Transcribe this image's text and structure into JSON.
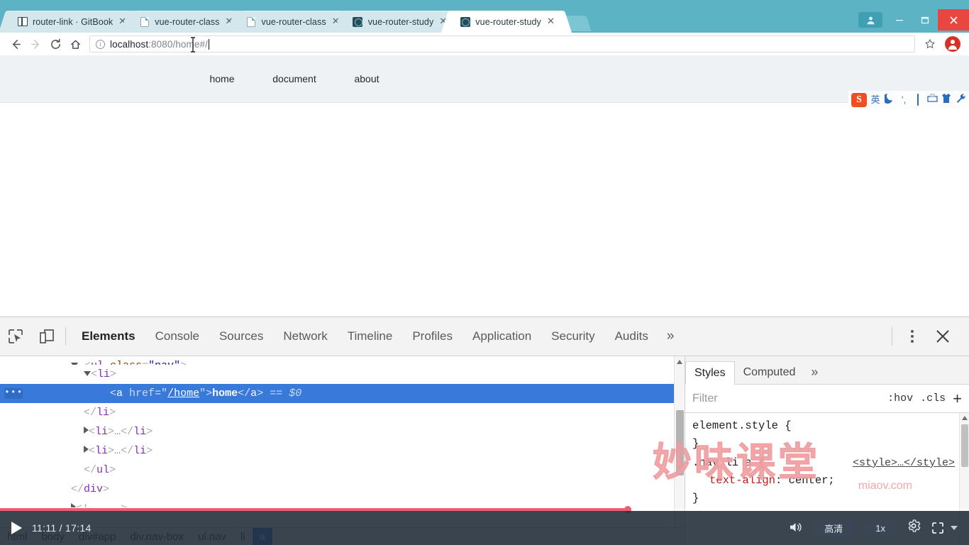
{
  "browser": {
    "tabs": [
      {
        "title": "router-link · GitBook",
        "favicon": "gitbook-icon",
        "active": false
      },
      {
        "title": "vue-router-class",
        "favicon": "page-icon",
        "active": false
      },
      {
        "title": "vue-router-class",
        "favicon": "page-icon",
        "active": false
      },
      {
        "title": "vue-router-study",
        "favicon": "vue-icon",
        "active": false
      },
      {
        "title": "vue-router-study",
        "favicon": "vue-icon",
        "active": true
      }
    ],
    "tab_close_label": "✕",
    "window_controls": {
      "user": "👤",
      "minimize": "—",
      "maximize": "❐",
      "close": "✕"
    },
    "toolbar": {
      "back": "←",
      "forward": "→",
      "reload": "⟳",
      "home": "⌂",
      "url_scheme_icon": "info-icon",
      "url_main": "localhost",
      "url_rest": ":8080/home#/",
      "url_full": "localhost:8080/home#/",
      "star": "☆"
    }
  },
  "page": {
    "nav": [
      {
        "label": "home",
        "href": "/home"
      },
      {
        "label": "document",
        "href": "/document"
      },
      {
        "label": "about",
        "href": "/about"
      }
    ],
    "ime": {
      "logo": "S",
      "items": [
        "英",
        "☽",
        "ʼ,",
        "keyboard-icon",
        "toolbox-icon",
        "shirt-icon",
        "wrench-icon"
      ]
    }
  },
  "devtools": {
    "left_icons": [
      "inspect-element-icon",
      "device-toolbar-icon"
    ],
    "tabs": [
      {
        "label": "Elements",
        "active": true
      },
      {
        "label": "Console",
        "active": false
      },
      {
        "label": "Sources",
        "active": false
      },
      {
        "label": "Network",
        "active": false
      },
      {
        "label": "Timeline",
        "active": false
      },
      {
        "label": "Profiles",
        "active": false
      },
      {
        "label": "Application",
        "active": false
      },
      {
        "label": "Security",
        "active": false
      },
      {
        "label": "Audits",
        "active": false
      }
    ],
    "more_tabs": "»",
    "kebab": "⋮",
    "close": "✕",
    "dom": {
      "lines": [
        {
          "id": "ul-open",
          "text": "<ul class=\"nav\">",
          "clipped": true
        },
        {
          "id": "li-open",
          "tag": "li",
          "marker": "▼"
        },
        {
          "id": "a-selected",
          "tagname": "a",
          "attr_name": "href",
          "attr_value": "/home",
          "inner_text": "home",
          "suffix": "== $0",
          "badge": "•••",
          "selected": true
        },
        {
          "id": "li-close",
          "text": "</li>"
        },
        {
          "id": "li-collapsed-1",
          "text": "<li>…</li>",
          "marker": "▶"
        },
        {
          "id": "li-collapsed-2",
          "text": "<li>…</li>",
          "marker": "▶"
        },
        {
          "id": "ul-close",
          "text": "</ul>"
        },
        {
          "id": "div-close",
          "text": "</div>"
        }
      ]
    },
    "breadcrumb": [
      "html",
      "body",
      "div#app",
      "div.nav-box",
      "ul.nav",
      "li",
      "a"
    ],
    "breadcrumb_active": "a",
    "styles": {
      "tabs": [
        {
          "label": "Styles",
          "active": true
        },
        {
          "label": "Computed",
          "active": false
        }
      ],
      "more": "»",
      "filter_placeholder": "Filter",
      "hov": ":hov",
      "cls": ".cls",
      "add": "+",
      "rules": [
        {
          "selector": "element.style {",
          "close": "}",
          "source": "",
          "declarations": []
        },
        {
          "selector": ".nav li a {",
          "close": "}",
          "source": "<style>…</style>",
          "declarations": [
            {
              "prop": "text-align",
              "value": "center;"
            }
          ]
        }
      ]
    }
  },
  "watermark": {
    "text": "妙味课堂",
    "site": "miaov.com"
  },
  "player": {
    "play_icon": "play-icon",
    "time": "11:11 / 17:14",
    "current_time": "11:11",
    "duration": "17:14",
    "quality": "高清",
    "speed": "1x",
    "gear": "⚙",
    "volume_icon": "volume-icon",
    "fullscreen_icon": "fullscreen-icon",
    "progress_percent": 64.8,
    "progress_color": "#ef5d74"
  },
  "colors": {
    "chrome_frame": "#5bb3c4",
    "tab_active": "#ffffff",
    "tab_inactive": "#d3e7ec",
    "selection_blue": "#3879d9",
    "close_red": "#e8473f",
    "nav_box_bg": "#eff2f5",
    "player_bg": "#202b38"
  }
}
